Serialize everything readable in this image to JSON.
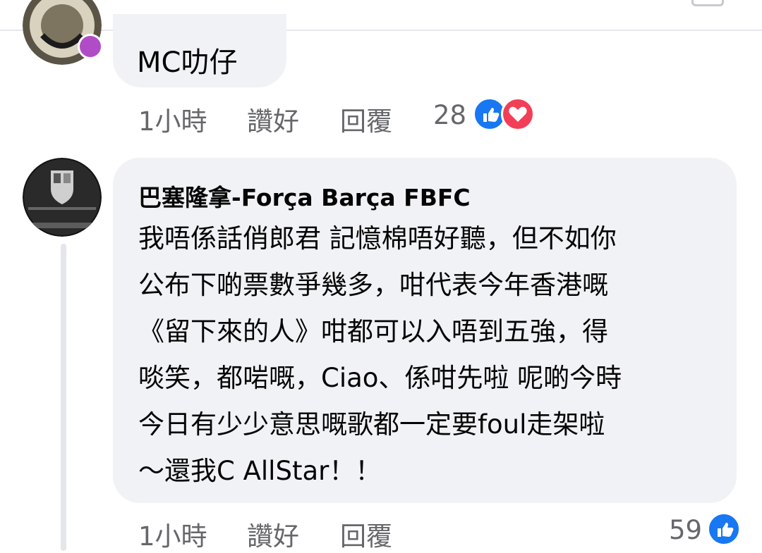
{
  "colors": {
    "bubble": "#f0f2f5",
    "meta_text": "#65676b",
    "like_blue": "#1877f2",
    "love_red": "#f33e58"
  },
  "comments": [
    {
      "avatar_icon": "vaccinated-badge-avatar",
      "text": "MC叻仔",
      "time": "1小時",
      "like_label": "讚好",
      "reply_label": "回覆",
      "reaction_count": "28",
      "reactions": [
        "like-icon",
        "love-icon"
      ]
    },
    {
      "avatar_icon": "fc-barcelona-crest-avatar",
      "author": "巴塞隆拿-Força Barça FBFC",
      "text_lines": [
        "我唔係話俏郎君 記憶棉唔好聽，但不如你",
        "公布下啲票數爭幾多，咁代表今年香港嘅",
        "《留下來的人》咁都可以入唔到五強，得",
        "啖笑，都啱嘅，Ciao、係咁先啦 呢啲今時",
        "今日有少少意思嘅歌都一定要foul走架啦",
        "～還我C AllStar！！"
      ],
      "time": "1小時",
      "like_label": "讚好",
      "reply_label": "回覆",
      "reaction_count": "59",
      "reactions": [
        "like-icon"
      ]
    }
  ]
}
